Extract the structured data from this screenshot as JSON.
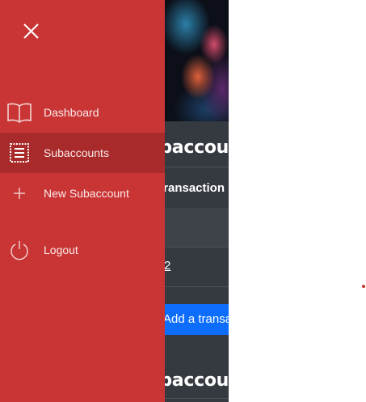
{
  "background_app": {
    "heading": "baccou",
    "heading_2": "baccou",
    "table_header": "ransaction",
    "row_link": "2",
    "add_button": "Add a transa"
  },
  "drawer": {
    "close_icon": "close-icon",
    "items": [
      {
        "label": "Dashboard",
        "icon": "book-icon",
        "active": false
      },
      {
        "label": "Subaccounts",
        "icon": "receipt-icon",
        "active": true
      },
      {
        "label": "New Subaccount",
        "icon": "plus-icon",
        "active": false
      },
      {
        "label": "Logout",
        "icon": "power-icon",
        "active": false
      }
    ]
  },
  "colors": {
    "drawer_bg": "#c93535",
    "drawer_active": "#a82a2a",
    "app_bg": "#343a40",
    "primary_button": "#0d6efd"
  }
}
